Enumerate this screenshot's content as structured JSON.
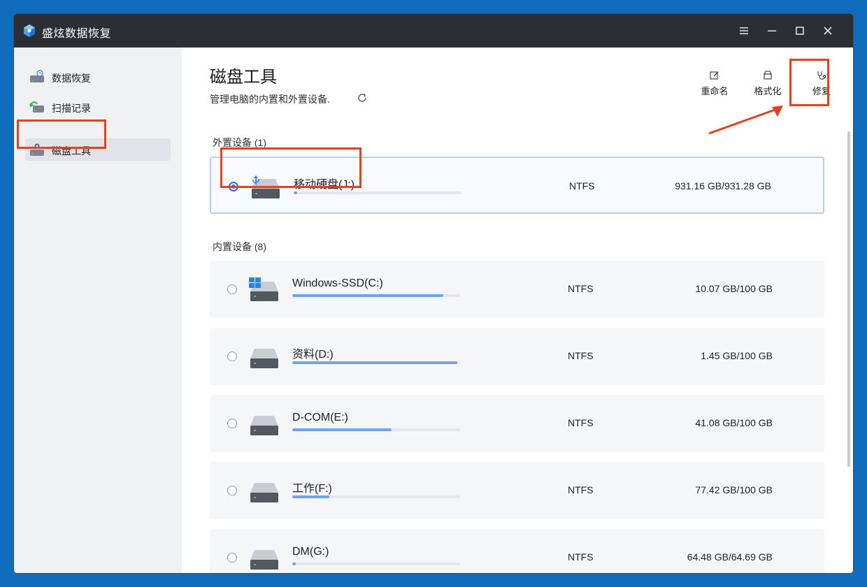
{
  "app": {
    "title": "盛炫数据恢复"
  },
  "titlebar": {
    "menu_icon": "hamburger-icon",
    "minimize_icon": "minimize-icon",
    "maximize_icon": "maximize-icon",
    "close_icon": "close-icon"
  },
  "sidebar": {
    "items": [
      {
        "label": "数据恢复",
        "icon": "drive-recover-icon",
        "active": false
      },
      {
        "label": "扫描记录",
        "icon": "scan-history-icon",
        "active": false
      },
      {
        "label": "磁盘工具",
        "icon": "disk-tool-icon",
        "active": true
      }
    ]
  },
  "header": {
    "title": "磁盘工具",
    "subtitle": "管理电脑的内置和外置设备.",
    "refresh_icon": "refresh-icon"
  },
  "toolbar": {
    "rename_label": "重命名",
    "format_label": "格式化",
    "repair_label": "修复"
  },
  "external": {
    "label": "外置设备 (1)",
    "disks": [
      {
        "name": "移动硬盘(J:)",
        "fs": "NTFS",
        "capacity": "931.16 GB/931.28 GB",
        "usage_fraction": 0.02,
        "selected": true,
        "badge": "usb-icon"
      }
    ]
  },
  "internal": {
    "label": "内置设备 (8)",
    "disks": [
      {
        "name": "Windows-SSD(C:)",
        "fs": "NTFS",
        "capacity": "10.07 GB/100 GB",
        "usage_fraction": 0.9,
        "selected": false,
        "badge": "windows-icon"
      },
      {
        "name": "资料(D:)",
        "fs": "NTFS",
        "capacity": "1.45 GB/100 GB",
        "usage_fraction": 0.985,
        "selected": false,
        "badge": ""
      },
      {
        "name": "D-COM(E:)",
        "fs": "NTFS",
        "capacity": "41.08 GB/100 GB",
        "usage_fraction": 0.59,
        "selected": false,
        "badge": ""
      },
      {
        "name": "工作(F:)",
        "fs": "NTFS",
        "capacity": "77.42 GB/100 GB",
        "usage_fraction": 0.22,
        "selected": false,
        "badge": ""
      },
      {
        "name": "DM(G:)",
        "fs": "NTFS",
        "capacity": "64.48 GB/64.69 GB",
        "usage_fraction": 0.02,
        "selected": false,
        "badge": ""
      }
    ]
  },
  "colors": {
    "accent": "#1a73e8",
    "highlight": "#e3421f",
    "titlebar": "#2c2e33",
    "usage_fill": "#6ea4ef"
  }
}
